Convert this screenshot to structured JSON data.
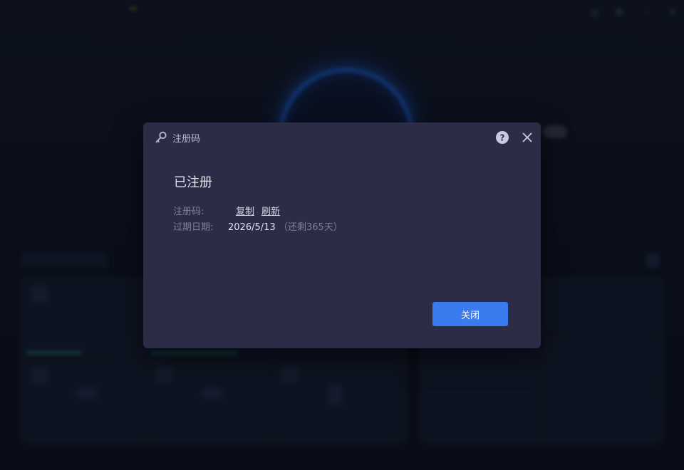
{
  "dialog": {
    "title": "注册码",
    "status": "已注册",
    "code_label": "注册码:",
    "copy_label": "复制",
    "refresh_label": "刷新",
    "expire_label": "过期日期:",
    "expire_date": "2026/5/13",
    "remaining": "（还剩365天）",
    "close_button": "关闭",
    "icons": {
      "title": "key-icon",
      "help": "help-icon",
      "close": "close-icon"
    }
  },
  "colors": {
    "dialog_bg": "#2c2c46",
    "primary_button": "#3b7bf0",
    "app_bg": "#131829"
  }
}
